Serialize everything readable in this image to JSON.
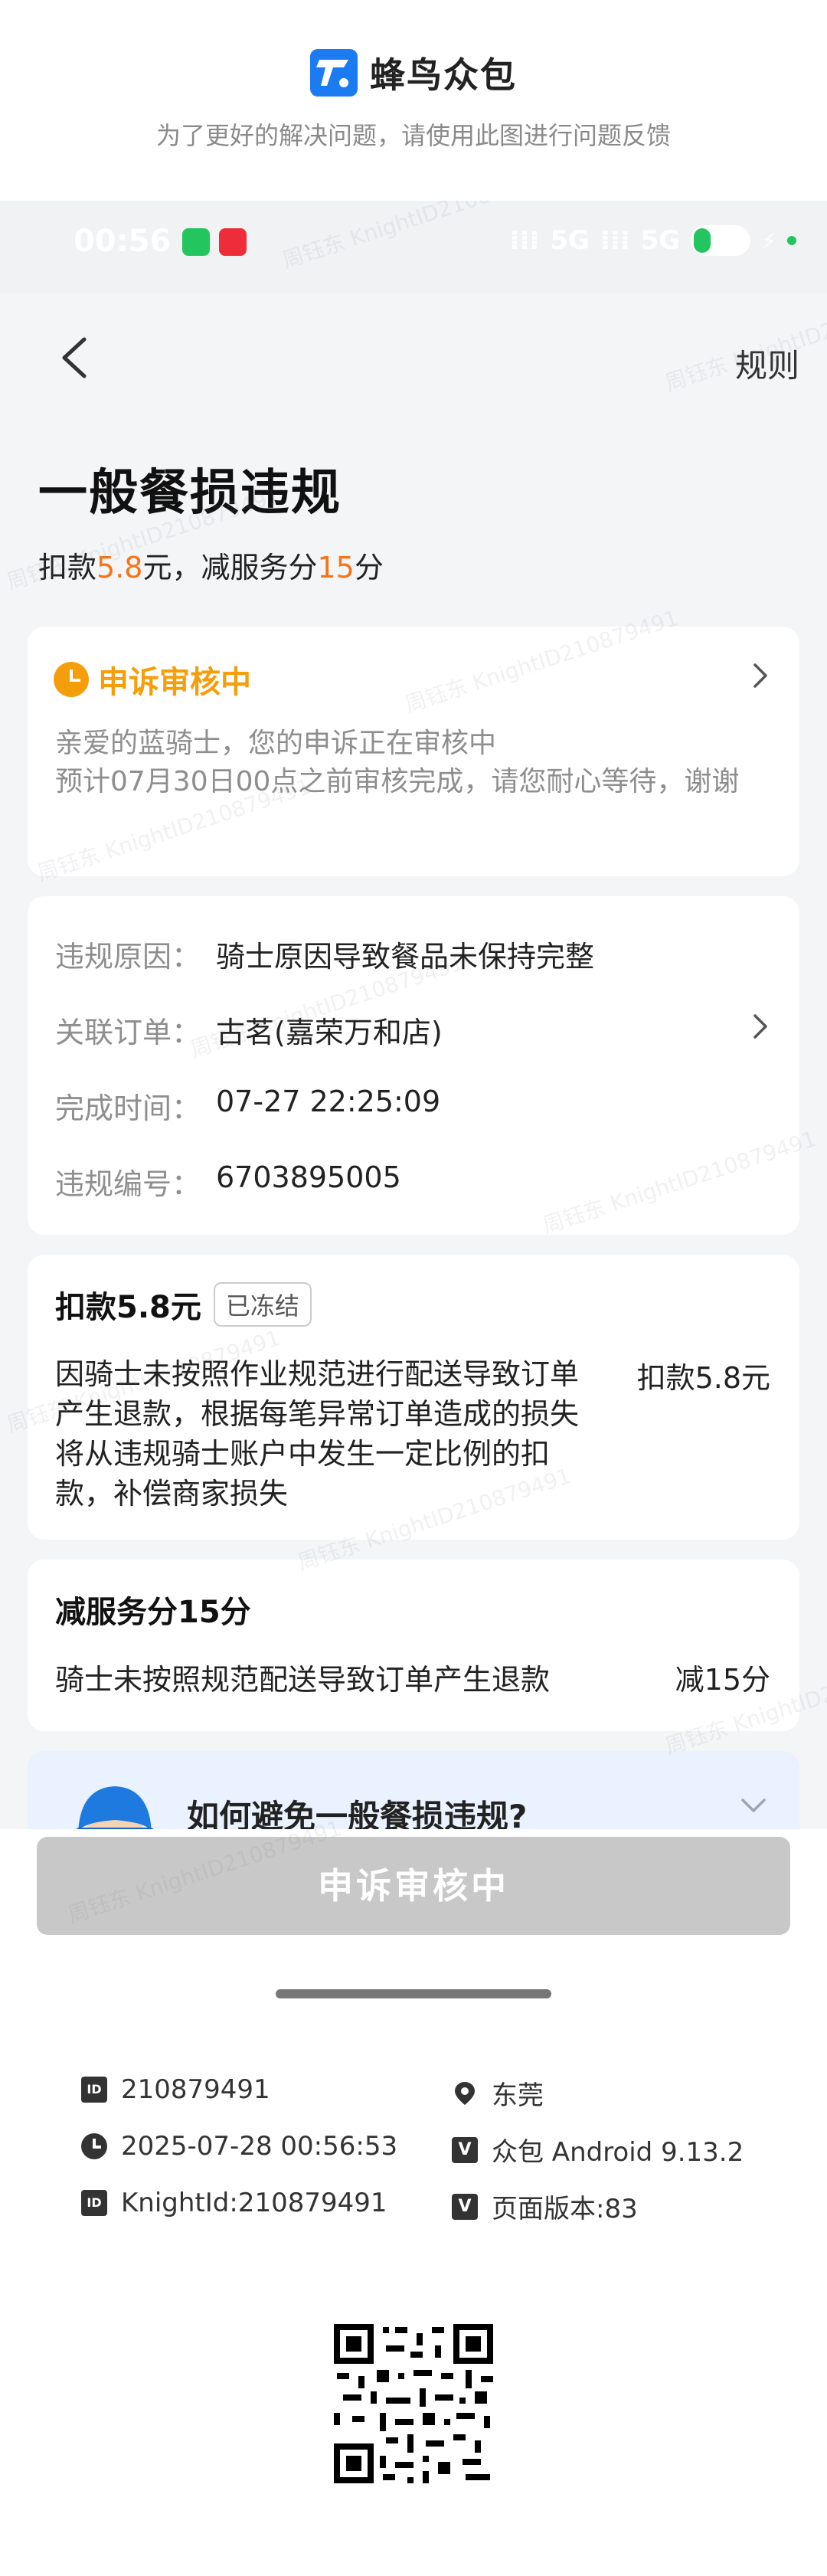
{
  "banner": {
    "brand_name": "蜂鸟众包",
    "subtitle": "为了更好的解决问题，请使用此图进行问题反馈"
  },
  "statusbar": {
    "time": "00:56",
    "signal1": "5G",
    "signal2": "5G",
    "battery": "16"
  },
  "navbar": {
    "rule_label": "规则"
  },
  "violation": {
    "title": "一般餐损违规",
    "sub_prefix": "扣款",
    "sub_amount": "5.8",
    "sub_mid": "元，减服务分",
    "sub_score": "15",
    "sub_suffix": "分"
  },
  "appeal": {
    "title": "申诉审核中",
    "line1": "亲爱的蓝骑士，您的申诉正在审核中",
    "line2": "预计07月30日00点之前审核完成，请您耐心等待，谢谢"
  },
  "details": [
    {
      "key": "违规原因：",
      "value": "骑士原因导致餐品未保持完整"
    },
    {
      "key": "关联订单：",
      "value": "古茗(嘉荣万和店)"
    },
    {
      "key": "完成时间：",
      "value": "07-27 22:25:09"
    },
    {
      "key": "违规编号：",
      "value": "6703895005"
    }
  ],
  "deduction": {
    "title": "扣款5.8元",
    "badge": "已冻结",
    "text": "因骑士未按照作业规范进行配送导致订单产生退款，根据每笔异常订单造成的损失将从违规骑士账户中发生一定比例的扣款，补偿商家损失",
    "amount": "扣款5.8元"
  },
  "service": {
    "title": "减服务分15分",
    "text": "骑士未按照规范配送导致订单产生退款",
    "amount": "减15分"
  },
  "avoid": {
    "title": "如何避免一般餐损违规?"
  },
  "bottom": {
    "button_label": "申诉审核中"
  },
  "footer": {
    "id": "210879491",
    "city": "东莞",
    "datetime": "2025-07-28 00:56:53",
    "app_version": "众包 Android 9.13.2",
    "knight_id": "KnightId:210879491",
    "page_version": "页面版本:83"
  },
  "watermark_text": "周钰东 KnightID210879491",
  "colors": {
    "accent_orange": "#f97316",
    "appeal_amber": "#f59e0b",
    "brand_blue": "#1a7cf0"
  }
}
